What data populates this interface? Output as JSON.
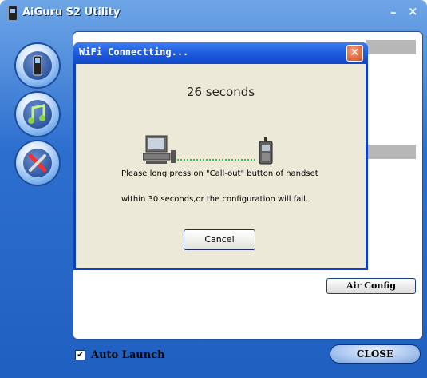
{
  "window": {
    "title": "AiGuru S2 Utility",
    "minimize": "–",
    "close": "×"
  },
  "nav": [
    {
      "name": "phone"
    },
    {
      "name": "music"
    },
    {
      "name": "tools"
    }
  ],
  "main": {
    "air_config_label": "Air Config"
  },
  "footer": {
    "auto_launch_label": "Auto Launch",
    "auto_launch_checked": true,
    "check_mark": "✔",
    "close_label": "CLOSE"
  },
  "dialog": {
    "title": "WiFi Connectting...",
    "close": "✕",
    "countdown": "26 seconds",
    "message_line1": "Please long press on \"Call-out\" button of handset",
    "message_line2": "within 30 seconds,or the configuration will fail.",
    "cancel_label": "Cancel"
  }
}
